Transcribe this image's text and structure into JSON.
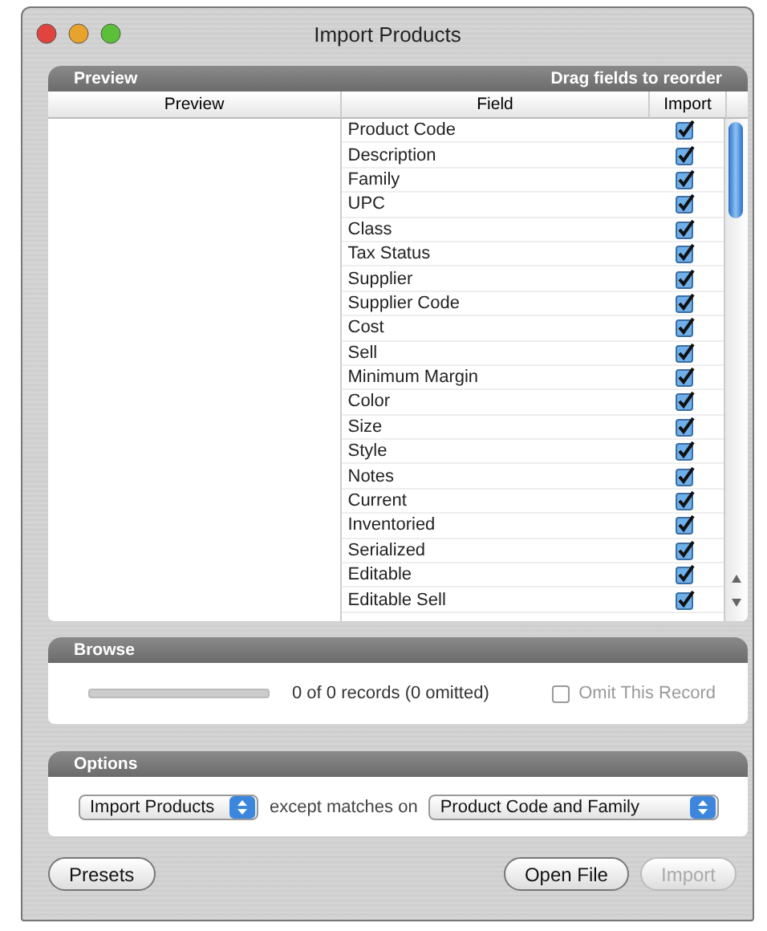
{
  "window": {
    "title": "Import Products"
  },
  "preview_panel": {
    "title": "Preview",
    "hint": "Drag fields to reorder",
    "columns": [
      "Preview",
      "Field",
      "Import"
    ],
    "rows": [
      {
        "field": "Product Code",
        "checked": true
      },
      {
        "field": "Description",
        "checked": true
      },
      {
        "field": "Family",
        "checked": true
      },
      {
        "field": "UPC",
        "checked": true
      },
      {
        "field": "Class",
        "checked": true
      },
      {
        "field": "Tax Status",
        "checked": true
      },
      {
        "field": "Supplier",
        "checked": true
      },
      {
        "field": "Supplier Code",
        "checked": true
      },
      {
        "field": "Cost",
        "checked": true
      },
      {
        "field": "Sell",
        "checked": true
      },
      {
        "field": "Minimum Margin",
        "checked": true
      },
      {
        "field": "Color",
        "checked": true
      },
      {
        "field": "Size",
        "checked": true
      },
      {
        "field": "Style",
        "checked": true
      },
      {
        "field": "Notes",
        "checked": true
      },
      {
        "field": "Current",
        "checked": true
      },
      {
        "field": "Inventoried",
        "checked": true
      },
      {
        "field": "Serialized",
        "checked": true
      },
      {
        "field": "Editable",
        "checked": true
      },
      {
        "field": "Editable Sell",
        "checked": true
      }
    ]
  },
  "browse_panel": {
    "title": "Browse",
    "records": "0 of 0 records (0 omitted)",
    "omit": {
      "label": "Omit This Record",
      "checked": false,
      "disabled": true
    }
  },
  "options_panel": {
    "title": "Options",
    "mode": "Import Products",
    "connector": "except matches on",
    "match": "Product Code and Family"
  },
  "buttons": [
    {
      "label": "Presets",
      "disabled": false
    },
    {
      "label": "Open File",
      "disabled": false
    },
    {
      "label": "Import",
      "disabled": true
    }
  ]
}
